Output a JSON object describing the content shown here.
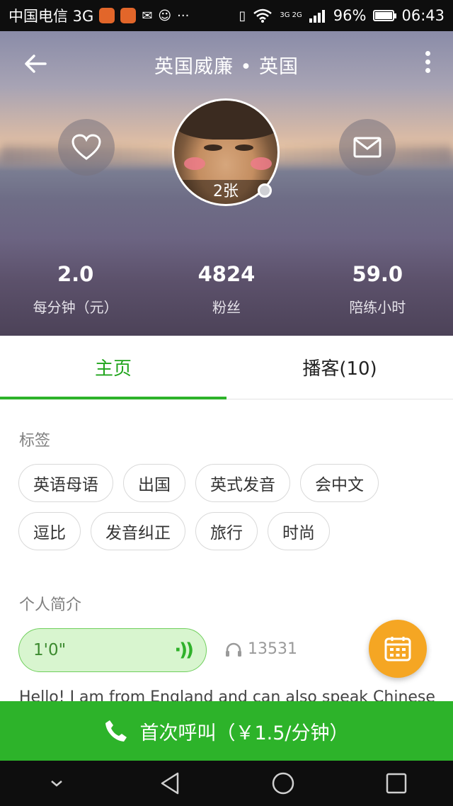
{
  "status_bar": {
    "carrier": "中国电信 3G",
    "signal_label": "3G 2G",
    "battery": "96%",
    "battery_level": 0.96,
    "time": "06:43"
  },
  "header": {
    "title": "英国威廉 • 英国",
    "photo_count": "2张"
  },
  "stats": [
    {
      "value": "2.0",
      "label": "每分钟（元）"
    },
    {
      "value": "4824",
      "label": "粉丝"
    },
    {
      "value": "59.0",
      "label": "陪练小时"
    }
  ],
  "tabs": [
    {
      "label": "主页",
      "active": true
    },
    {
      "label": "播客(10)",
      "active": false
    }
  ],
  "tags_section": {
    "title": "标签",
    "rows": [
      [
        "英语母语",
        "出国",
        "英式发音",
        "会中文"
      ],
      [
        "逗比",
        "发音纠正",
        "旅行",
        "时尚"
      ]
    ]
  },
  "intro_section": {
    "title": "个人简介",
    "voice_duration": "1'0\"",
    "listen_count": "13531",
    "text": "Hello! I am from England and can also speak Chinese"
  },
  "call_button": {
    "label": "首次呼叫（￥1.5/分钟）"
  },
  "colors": {
    "accent_green": "#2db32a",
    "fab_orange": "#f5a623"
  }
}
